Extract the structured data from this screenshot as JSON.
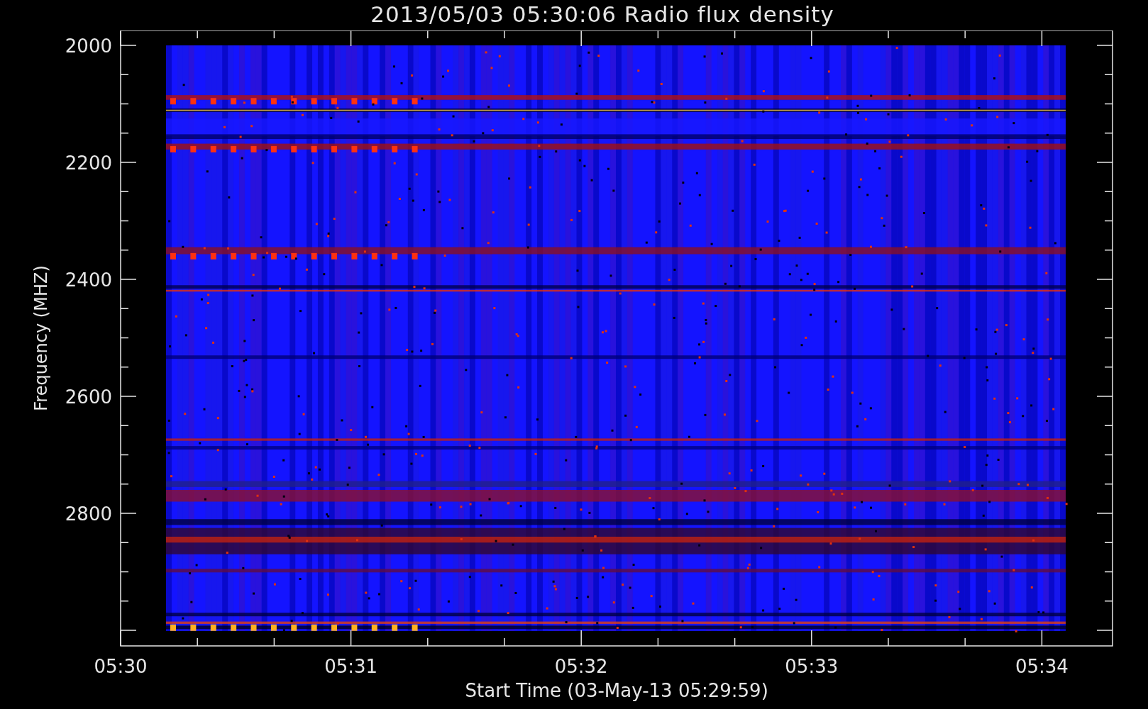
{
  "title": "2013/05/03 05:30:06 Radio flux density",
  "plot": {
    "ylabel": "Frequency (MHZ)",
    "xlabel": "Start Time (03-May-13 05:29:59)",
    "yticks": [
      "2000",
      "2200",
      "2400",
      "2600",
      "2800"
    ],
    "xticks": [
      "05:30",
      "05:31",
      "05:32",
      "05:33",
      "05:34"
    ]
  }
}
